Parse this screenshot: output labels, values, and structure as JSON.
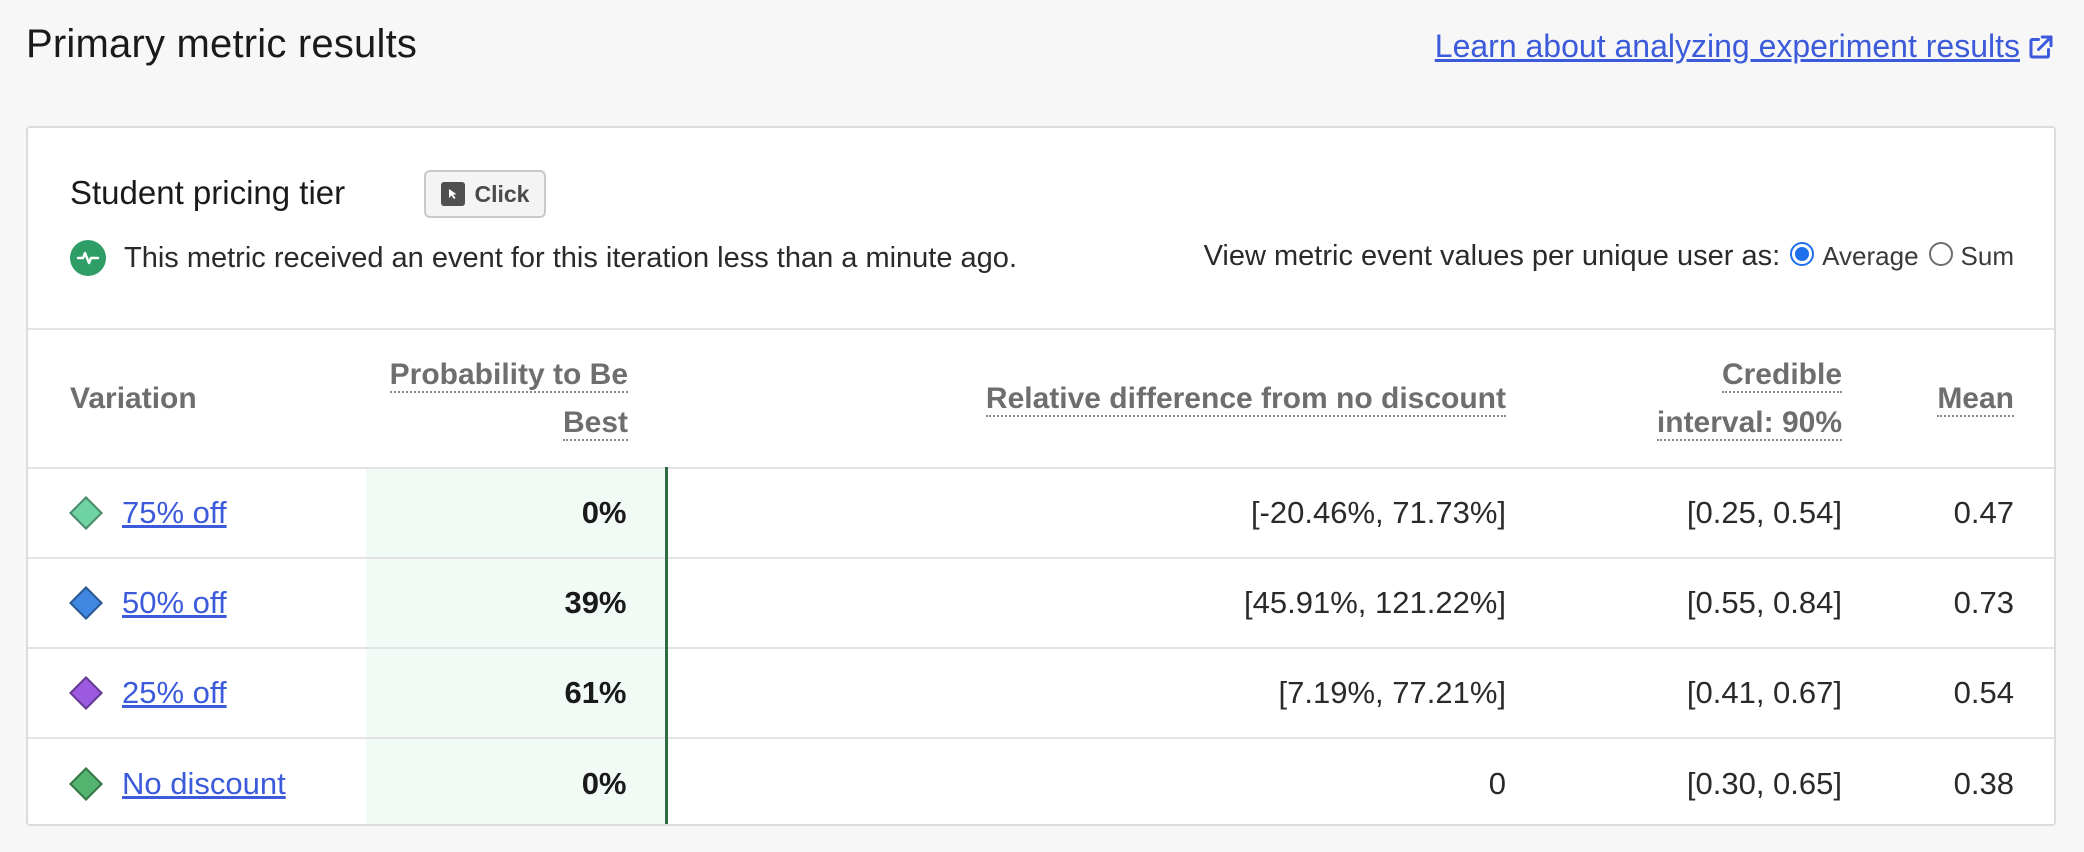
{
  "header": {
    "title": "Primary metric results",
    "learn_link": "Learn about analyzing experiment results"
  },
  "metric": {
    "name": "Student pricing tier",
    "kind_badge": "Click",
    "status": "This metric received an event for this iteration less than a minute ago.",
    "view_as_label": "View metric event values per unique user as:",
    "options": [
      {
        "label": "Average",
        "selected": true
      },
      {
        "label": "Sum",
        "selected": false
      }
    ]
  },
  "table": {
    "headers": {
      "variation": "Variation",
      "prob_line1": "Probability to Be",
      "prob_line2": "Best",
      "relative": "Relative difference from no discount",
      "ci_line1": "Credible",
      "ci_line2": "interval: 90%",
      "mean": "Mean"
    },
    "rows": [
      {
        "name": "75% off",
        "color": "#6fd3a4",
        "prob": "0%",
        "relative": "[-20.46%, 71.73%]",
        "ci": "[0.25, 0.54]",
        "mean": "0.47"
      },
      {
        "name": "50% off",
        "color": "#3f87e0",
        "prob": "39%",
        "relative": "[45.91%, 121.22%]",
        "ci": "[0.55, 0.84]",
        "mean": "0.73"
      },
      {
        "name": "25% off",
        "color": "#9c5ae0",
        "prob": "61%",
        "relative": "[7.19%, 77.21%]",
        "ci": "[0.41, 0.67]",
        "mean": "0.54"
      },
      {
        "name": "No discount",
        "color": "#52b46e",
        "prob": "0%",
        "relative": "0",
        "ci": "[0.30, 0.65]",
        "mean": "0.38"
      }
    ]
  }
}
